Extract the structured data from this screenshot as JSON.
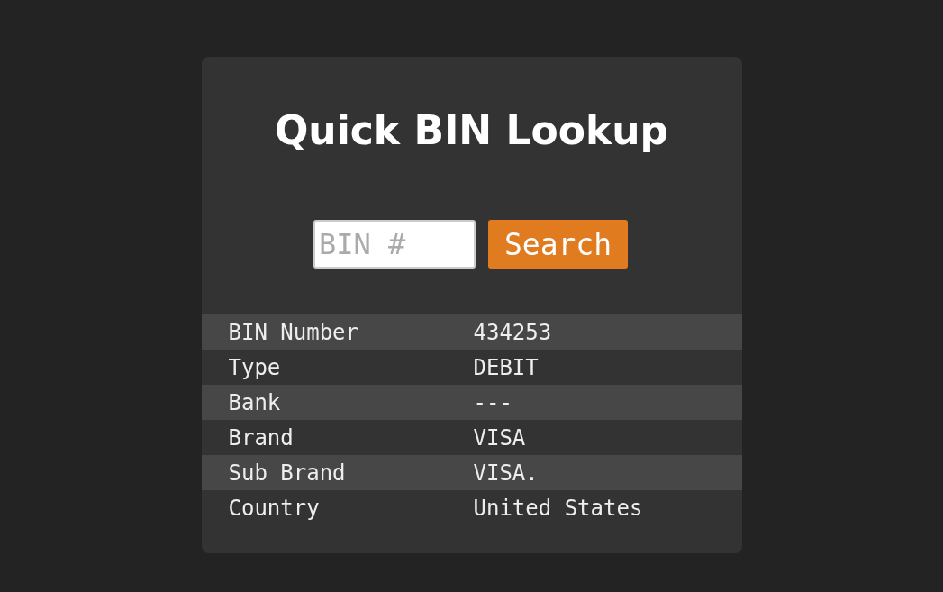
{
  "title": "Quick BIN Lookup",
  "search": {
    "placeholder": "BIN #",
    "button": "Search"
  },
  "rows": [
    {
      "label": "BIN Number",
      "value": "434253"
    },
    {
      "label": "Type",
      "value": "DEBIT"
    },
    {
      "label": "Bank",
      "value": "---"
    },
    {
      "label": "Brand",
      "value": "VISA"
    },
    {
      "label": "Sub Brand",
      "value": "VISA."
    },
    {
      "label": "Country",
      "value": "United States"
    }
  ]
}
